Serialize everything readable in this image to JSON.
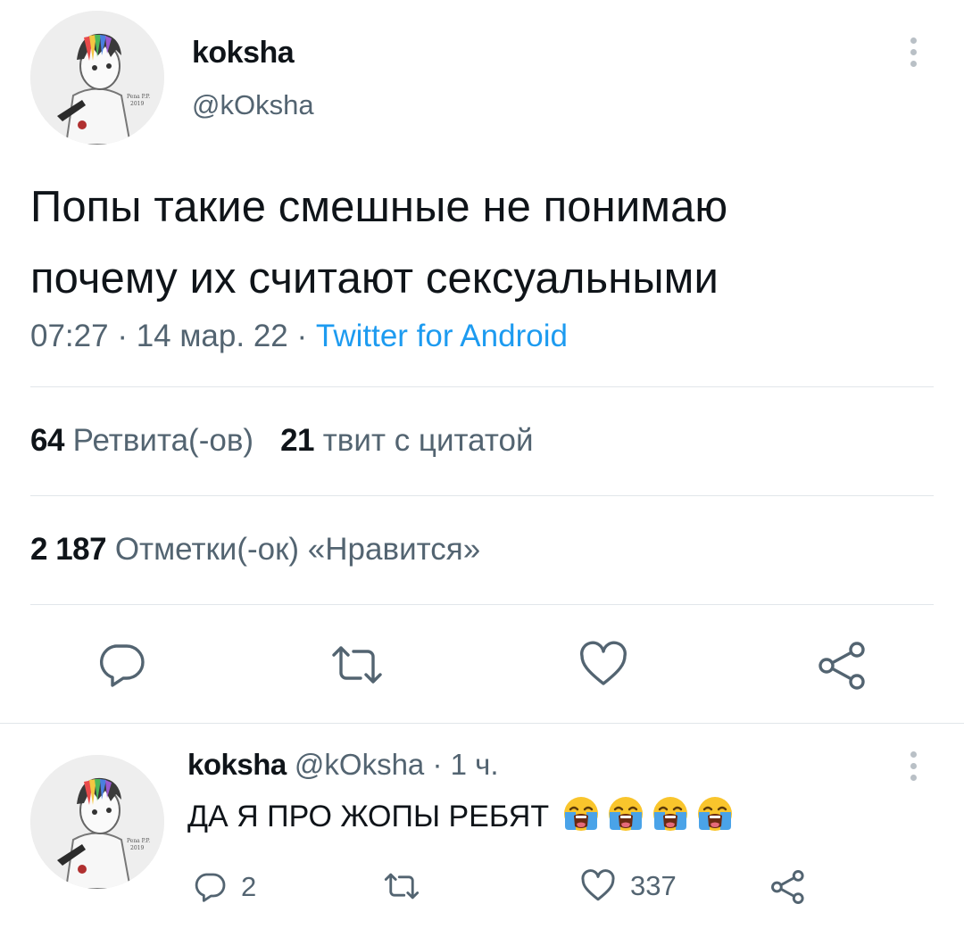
{
  "main_tweet": {
    "display_name": "koksha",
    "handle": "@kOksha",
    "text_line1": "Попы такие смешные не понимаю",
    "text_line2": "почему их считают сексуальными",
    "time": "07:27",
    "date": "14 мар. 22",
    "source": "Twitter for Android",
    "retweets_count": "64",
    "retweets_label": "Ретвита(-ов)",
    "quotes_count": "21",
    "quotes_label": "твит с цитатой",
    "likes_count": "2 187",
    "likes_label": "Отметки(-ок) «Нравится»"
  },
  "reply_tweet": {
    "display_name": "koksha",
    "handle": "@kOksha",
    "time_ago": "1 ч.",
    "text": "ДА Я ПРО ЖОПЫ РЕБЯТ",
    "emoji": [
      "loudly-crying-face",
      "loudly-crying-face",
      "loudly-crying-face",
      "loudly-crying-face"
    ],
    "reply_count": "2",
    "retweet_count": "",
    "like_count": "337"
  },
  "separator": "·",
  "colors": {
    "text_primary": "#0f1419",
    "text_secondary": "#536471",
    "link": "#1d9bf0",
    "divider": "#e1e6ea",
    "icon": "#536471"
  }
}
